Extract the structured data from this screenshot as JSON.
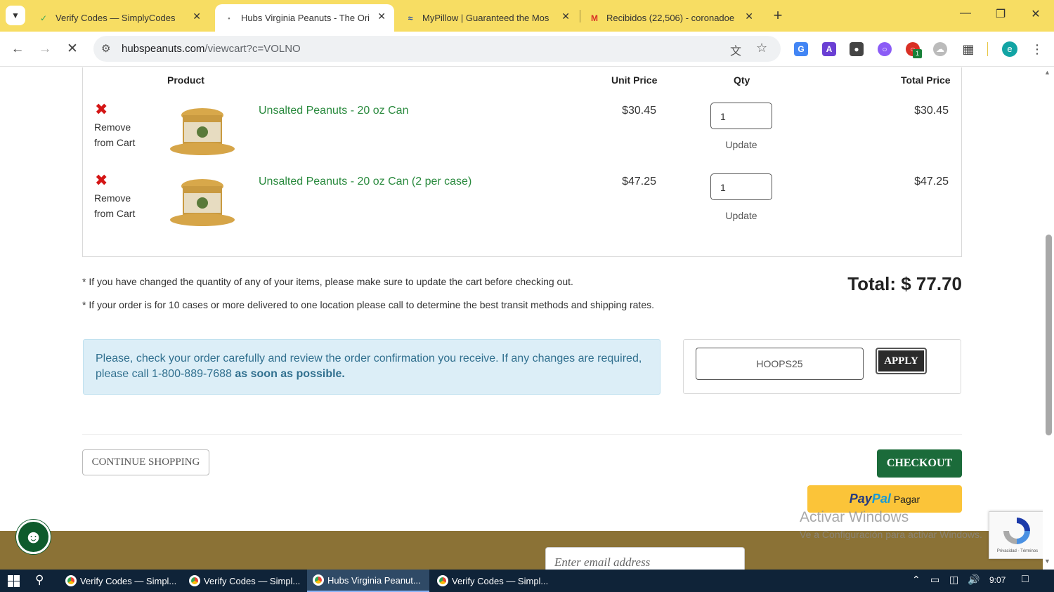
{
  "browser": {
    "tabs": [
      {
        "title": "Verify Codes — SimplyCodes",
        "icon": "simplycodes-icon",
        "active": false
      },
      {
        "title": "Hubs Virginia Peanuts - The Ori",
        "icon": "loading-icon",
        "active": true
      },
      {
        "title": "MyPillow | Guaranteed the Mos",
        "icon": "mypillow-icon",
        "active": false
      },
      {
        "title": "Recibidos (22,506) - coronadoe",
        "icon": "gmail-icon",
        "active": false
      }
    ],
    "url_domain": "hubspeanuts.com",
    "url_path": "/viewcart?c=VOLNO",
    "profile_initial": "e",
    "extension_badge": "1"
  },
  "cart": {
    "headers": {
      "product": "Product",
      "unit_price": "Unit Price",
      "qty": "Qty",
      "total_price": "Total Price"
    },
    "remove_label_1": "Remove",
    "remove_label_2": "from Cart",
    "update_label": "Update",
    "items": [
      {
        "name": "Unsalted Peanuts - 20 oz Can",
        "unit_price": "$30.45",
        "qty": "1",
        "total": "$30.45"
      },
      {
        "name": "Unsalted Peanuts - 20 oz Can (2 per case)",
        "unit_price": "$47.25",
        "qty": "1",
        "total": "$47.25"
      }
    ]
  },
  "notes": {
    "note1": "If you have changed the quantity of any of your items, please make sure to update the cart before checking out.",
    "note2": "If your order is for 10 cases or more delivered to one location please call to determine the best transit methods and shipping rates."
  },
  "total_label": "Total: $ 77.70",
  "info": {
    "text": "Please, check your order carefully and review the order confirmation you receive. If any changes are required, please call 1-800-889-7688",
    "bold": "as soon as possible."
  },
  "coupon": {
    "value": "HOOPS25",
    "apply_label": "APPLY"
  },
  "buttons": {
    "continue": "CONTINUE SHOPPING",
    "checkout": "CHECKOUT",
    "paypal_a": "Pay",
    "paypal_b": "Pal",
    "paypal_c": "Pagar"
  },
  "footer": {
    "email_placeholder": "Enter email address"
  },
  "watermark": {
    "line1": "Activar Windows",
    "line2": "Ve a Configuración para activar Windows."
  },
  "recaptcha": {
    "text": "Privacidad - Términos"
  },
  "taskbar": {
    "apps": [
      "Verify Codes — Simpl...",
      "Verify Codes — Simpl...",
      "Hubs Virginia Peanut...",
      "Verify Codes — Simpl..."
    ],
    "time": "9:07"
  },
  "colors": {
    "tabbar": "#f7dd63",
    "product_link": "#2a8a3e",
    "remove": "#d41515",
    "checkout": "#1b6b3a",
    "paypal": "#fbc439",
    "footer": "#8b7236",
    "info_bg": "#dceef7"
  }
}
